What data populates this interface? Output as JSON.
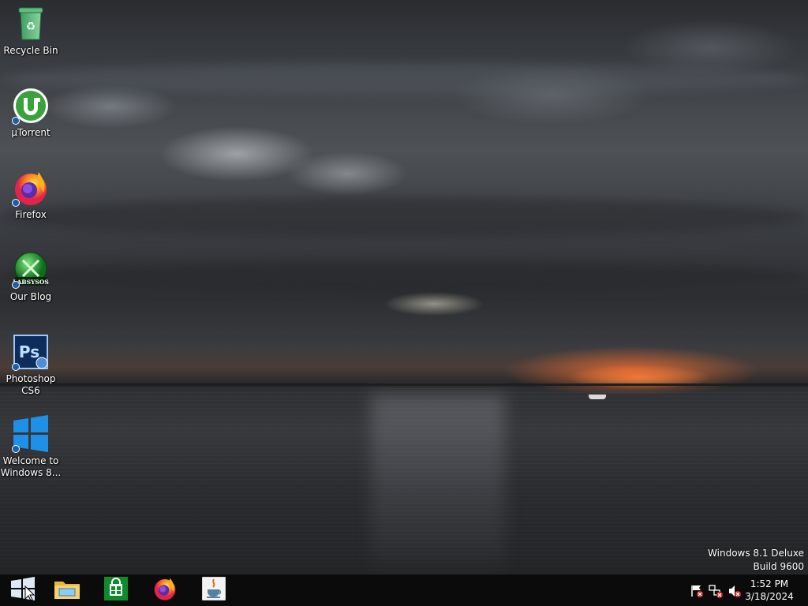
{
  "desktop": {
    "icons": [
      {
        "label": "Recycle Bin",
        "icon": "recycle-bin-icon"
      },
      {
        "label": "µTorrent",
        "icon": "utorrent-icon"
      },
      {
        "label": "Firefox",
        "icon": "firefox-icon"
      },
      {
        "label": "Our Blog",
        "icon": "blog-icon",
        "badge": "LABSYSOS"
      },
      {
        "label": "Photoshop CS6",
        "icon": "photoshop-icon",
        "badge": "Ps"
      },
      {
        "label": "Welcome to Windows 8...",
        "icon": "windows-logo-icon"
      }
    ]
  },
  "watermark": {
    "line1": "Windows 8.1 Deluxe",
    "line2": "Build 9600"
  },
  "taskbar": {
    "start": {
      "icon": "windows-start-icon"
    },
    "pinned": [
      {
        "name": "File Explorer",
        "icon": "file-explorer-icon"
      },
      {
        "name": "Store",
        "icon": "store-icon"
      },
      {
        "name": "Firefox",
        "icon": "firefox-icon"
      },
      {
        "name": "Java",
        "icon": "java-icon"
      }
    ],
    "tray": [
      {
        "name": "Action Center",
        "icon": "flag-icon"
      },
      {
        "name": "Network",
        "icon": "network-icon"
      },
      {
        "name": "Volume",
        "icon": "volume-muted-icon"
      }
    ],
    "clock": {
      "time": "1:52 PM",
      "date": "3/18/2024"
    }
  },
  "colors": {
    "taskbar": "#0b0b0c",
    "windows_blue": "#1e90e8",
    "sunset": "#ee6e32"
  }
}
